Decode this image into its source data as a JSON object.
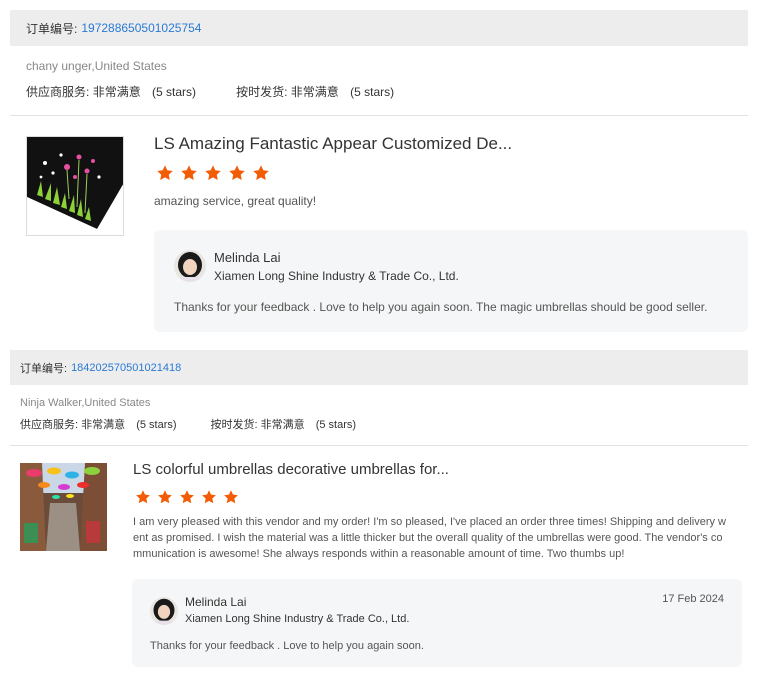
{
  "labels": {
    "order_no": "订单编号:",
    "supplier_service": "供应商服务:",
    "on_time": "按时发货:"
  },
  "orders": [
    {
      "order_number": "197288650501025754",
      "buyer": "chany unger,United States",
      "supplier_rating": "非常满意",
      "supplier_stars": "(5 stars)",
      "shipping_rating": "非常满意",
      "shipping_stars": "(5 stars)",
      "product_title": "LS Amazing Fantastic Appear Customized De...",
      "rating": 5,
      "review": "amazing service, great quality!",
      "reply": {
        "name": "Melinda Lai",
        "company": "Xiamen Long Shine Industry & Trade Co., Ltd.",
        "text": "Thanks for your feedback . Love to help you again  soon. The magic umbrellas should be good seller.",
        "date": ""
      }
    },
    {
      "order_number": "184202570501021418",
      "buyer": "Ninja Walker,United States",
      "supplier_rating": "非常满意",
      "supplier_stars": "(5 stars)",
      "shipping_rating": "非常满意",
      "shipping_stars": "(5 stars)",
      "product_title": "LS colorful umbrellas decorative umbrellas for...",
      "rating": 5,
      "review_lines": [
        "I am very pleased with this vendor and my order! I'm so pleased, I've placed an order three times! Shipping and delivery w",
        "ent as promised. I wish the material was a little thicker but the overall quality of the umbrellas were good. The vendor's co",
        "mmunication is awesome! She always responds within a reasonable amount of time. Two thumbs up!"
      ],
      "reply": {
        "name": "Melinda Lai",
        "company": "Xiamen Long Shine Industry & Trade Co., Ltd.",
        "text": "Thanks for your feedback . Love to help you again  soon.",
        "date": "17 Feb 2024"
      }
    }
  ],
  "colors": {
    "star": "#f25c05",
    "link": "#2a7ad5",
    "header_bg": "#ededed",
    "reply_bg": "#f5f6f7"
  }
}
